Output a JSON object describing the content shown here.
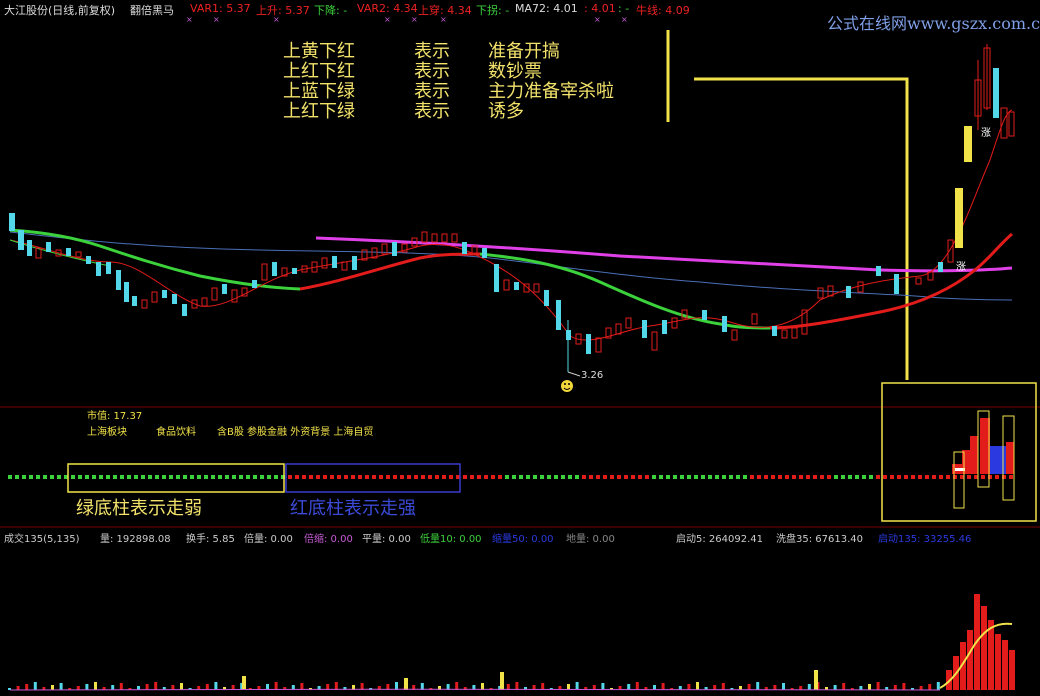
{
  "header": {
    "title": "大江股份(日线,前复权)",
    "indicator": "翻倍黑马",
    "var1_label": "VAR1: 5.37",
    "up_label": "上升: 5.37",
    "down_label": "下降: -",
    "var2_label": "VAR2: 4.34",
    "up_cross_label": "上穿: 4.34",
    "down_turn_label": "下拐: -",
    "ma72_label": "MA72: 4.01",
    "val_label": ": 4.01",
    "dash_label": ": -",
    "bull_label": "牛线: 4.09"
  },
  "watermark": {
    "cn": "公式在线网",
    "url": "www.gszx.com.cn"
  },
  "legend": [
    {
      "left": "上黄下红",
      "mid": "表示",
      "right": "准备开搞"
    },
    {
      "left": "上红下红",
      "mid": "表示",
      "right": "数钞票"
    },
    {
      "left": "上蓝下绿",
      "mid": "表示",
      "right": "主力准备宰杀啦"
    },
    {
      "left": "上红下绿",
      "mid": "表示",
      "right": "诱多"
    }
  ],
  "price": {
    "low_label": "3.26",
    "zhang1": "涨",
    "zhang2": "涨"
  },
  "info": {
    "market_value": "市值: 17.37",
    "sector": "上海板块",
    "industry": "食品饮料",
    "concepts": "含B股 参股金融 外资背景 上海自贸"
  },
  "captions": {
    "green": "绿底柱表示走弱",
    "red": "红底柱表示走强"
  },
  "volume": {
    "title": "成交135(5,135)",
    "vol": "量: 192898.08",
    "turnover": "换手: 5.85",
    "multi": "倍量: 0.00",
    "shrink": "倍缩: 0.00",
    "flat": "平量: 0.00",
    "low": "低量10: 0.00",
    "shrink50": "缩量50: 0.00",
    "ground": "地量: 0.00",
    "start5": "启动5: 264092.41",
    "wash": "洗盘35: 67613.40",
    "startup135": "启动135: 33255.46"
  },
  "colors": {
    "green": "#3cd23c",
    "red": "#e21b1b",
    "cyan": "#52d8e8",
    "yellow": "#f2e24a",
    "magenta": "#e040e8"
  }
}
